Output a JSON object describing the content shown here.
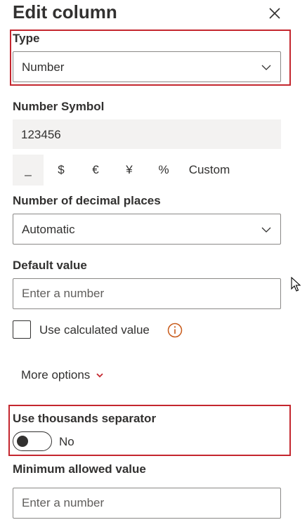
{
  "panel": {
    "title": "Edit column"
  },
  "type": {
    "label": "Type",
    "value": "Number"
  },
  "number_symbol": {
    "label": "Number Symbol",
    "preview": "123456",
    "options": [
      "_",
      "$",
      "€",
      "¥",
      "%",
      "Custom"
    ],
    "selected": "_"
  },
  "decimal_places": {
    "label": "Number of decimal places",
    "value": "Automatic"
  },
  "default_value": {
    "label": "Default value",
    "placeholder": "Enter a number",
    "use_calculated_label": "Use calculated value"
  },
  "more_options": {
    "label": "More options"
  },
  "thousands_separator": {
    "label": "Use thousands separator",
    "state": "No"
  },
  "minimum_value": {
    "label": "Minimum allowed value",
    "placeholder": "Enter a number"
  },
  "colors": {
    "highlight": "#c4262e",
    "info": "#c85a1a",
    "accent": "#c4262e"
  }
}
